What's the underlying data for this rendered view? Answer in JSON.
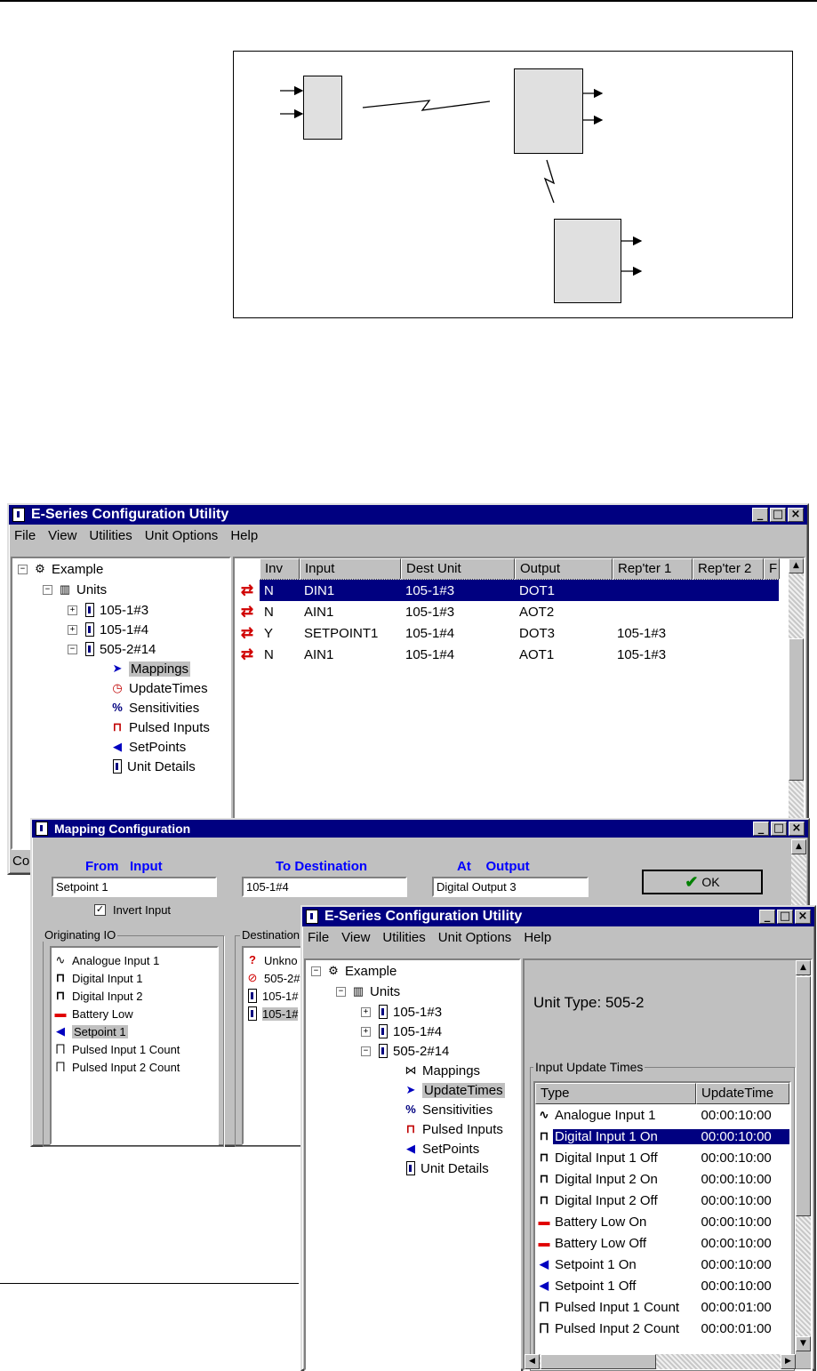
{
  "win1": {
    "title": "E-Series Configuration Utility",
    "menu": [
      "File",
      "View",
      "Utilities",
      "Unit Options",
      "Help"
    ],
    "tree": {
      "root": "Example",
      "units": "Units",
      "unit_a": "105-1#3",
      "unit_b": "105-1#4",
      "unit_c": "505-2#14",
      "children": [
        "Mappings",
        "UpdateTimes",
        "Sensitivities",
        "Pulsed Inputs",
        "SetPoints",
        "Unit Details"
      ]
    },
    "grid": {
      "headers": [
        "Inv",
        "Input",
        "Dest Unit",
        "Output",
        "Rep'ter 1",
        "Rep'ter 2",
        "F"
      ],
      "rows": [
        {
          "inv": "N",
          "input": "DIN1",
          "dest": "105-1#3",
          "output": "DOT1",
          "rep1": ""
        },
        {
          "inv": "N",
          "input": "AIN1",
          "dest": "105-1#3",
          "output": "AOT2",
          "rep1": ""
        },
        {
          "inv": "Y",
          "input": "SETPOINT1",
          "dest": "105-1#4",
          "output": "DOT3",
          "rep1": "105-1#3"
        },
        {
          "inv": "N",
          "input": "AIN1",
          "dest": "105-1#4",
          "output": "AOT1",
          "rep1": "105-1#3"
        }
      ]
    },
    "status_fragment": "Co"
  },
  "dialog": {
    "title": "Mapping Configuration",
    "from_label": "From   Input",
    "to_label": "To Destination",
    "at_label": "At    Output",
    "from_value": "Setpoint 1",
    "to_value": "105-1#4",
    "at_value": "Digital Output 3",
    "ok_label": "OK",
    "invert_label": "Invert Input",
    "invert_checked": true,
    "originating_label": "Originating IO",
    "originating": [
      "Analogue Input 1",
      "Digital Input 1",
      "Digital Input 2",
      "Battery Low",
      "Setpoint 1",
      "Pulsed Input 1 Count",
      "Pulsed Input 2 Count"
    ],
    "destination_label": "Destination",
    "destinations": [
      "Unkno",
      "505-2#",
      "105-1#",
      "105-1#"
    ]
  },
  "win2": {
    "title": "E-Series Configuration Utility",
    "menu": [
      "File",
      "View",
      "Utilities",
      "Unit Options",
      "Help"
    ],
    "tree": {
      "root": "Example",
      "units": "Units",
      "unit_a": "105-1#3",
      "unit_b": "105-1#4",
      "unit_c": "505-2#14",
      "children": [
        "Mappings",
        "UpdateTimes",
        "Sensitivities",
        "Pulsed Inputs",
        "SetPoints",
        "Unit Details"
      ]
    },
    "unit_type": "Unit Type: 505-2",
    "group_label": "Input Update Times",
    "headers": [
      "Type",
      "UpdateTime"
    ],
    "rows": [
      {
        "type": "Analogue Input 1",
        "time": "00:00:10:00"
      },
      {
        "type": "Digital Input 1 On",
        "time": "00:00:10:00"
      },
      {
        "type": "Digital Input 1 Off",
        "time": "00:00:10:00"
      },
      {
        "type": "Digital Input 2 On",
        "time": "00:00:10:00"
      },
      {
        "type": "Digital Input 2 Off",
        "time": "00:00:10:00"
      },
      {
        "type": "Battery Low On",
        "time": "00:00:10:00"
      },
      {
        "type": "Battery Low Off",
        "time": "00:00:10:00"
      },
      {
        "type": "Setpoint 1 On",
        "time": "00:00:10:00"
      },
      {
        "type": "Setpoint 1 Off",
        "time": "00:00:10:00"
      },
      {
        "type": "Pulsed Input 1 Count",
        "time": "00:00:01:00"
      },
      {
        "type": "Pulsed Input 2 Count",
        "time": "00:00:01:00"
      }
    ]
  },
  "colors": {
    "titlebar": "#000080",
    "selection": "#000080",
    "blue_label": "#0000ff",
    "arrow_red": "#d00000"
  }
}
